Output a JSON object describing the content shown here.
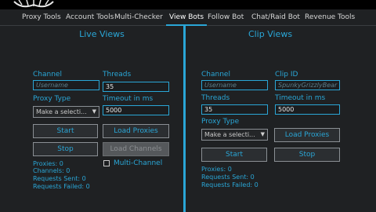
{
  "tabs": [
    {
      "label": "Proxy Tools"
    },
    {
      "label": "Account Tools"
    },
    {
      "label": "Multi-Checker"
    },
    {
      "label": "View Bots"
    },
    {
      "label": "Follow Bot"
    },
    {
      "label": "Chat/Raid Bot"
    },
    {
      "label": "Revenue Tools"
    }
  ],
  "active_tab": "View Bots",
  "accent_color": "#2aa6d6",
  "live": {
    "title": "Live Views",
    "channel_label": "Channel",
    "channel_placeholder": "Username",
    "threads_label": "Threads",
    "threads_value": "35",
    "proxy_type_label": "Proxy Type",
    "proxy_select": "Make a selecti...",
    "timeout_label": "Timeout in ms",
    "timeout_value": "5000",
    "start_button": "Start",
    "load_proxies_button": "Load Proxies",
    "stop_button": "Stop",
    "load_channels_button": "Load Channels",
    "multi_channel_label": "Multi-Channel",
    "stats": {
      "proxies": "Proxies: 0",
      "channels": "Channels: 0",
      "requests_sent": "Requests Sent: 0",
      "requests_failed": "Requests Failed: 0"
    }
  },
  "clip": {
    "title": "Clip Views",
    "channel_label": "Channel",
    "channel_placeholder": "Username",
    "clip_id_label": "Clip ID",
    "clip_id_value": "SpunkyGrizzlyBear",
    "threads_label": "Threads",
    "threads_value": "35",
    "timeout_label": "Timeout in ms",
    "timeout_value": "5000",
    "proxy_type_label": "Proxy Type",
    "proxy_select": "Make a selecti...",
    "load_proxies_button": "Load Proxies",
    "start_button": "Start",
    "stop_button": "Stop",
    "stats": {
      "proxies": "Proxies: 0",
      "requests_sent": "Requests Sent: 0",
      "requests_failed": "Requests Failed: 0"
    }
  }
}
